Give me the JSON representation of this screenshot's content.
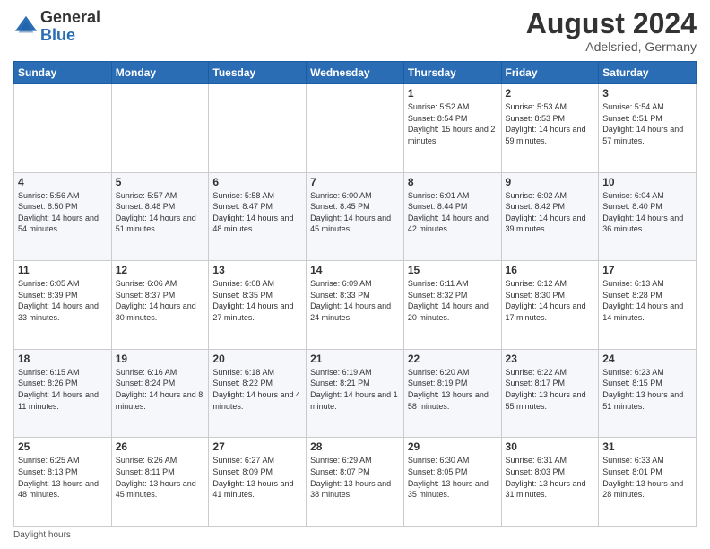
{
  "header": {
    "logo_general": "General",
    "logo_blue": "Blue",
    "month_year": "August 2024",
    "location": "Adelsried, Germany"
  },
  "days_of_week": [
    "Sunday",
    "Monday",
    "Tuesday",
    "Wednesday",
    "Thursday",
    "Friday",
    "Saturday"
  ],
  "weeks": [
    [
      {
        "day": "",
        "sunrise": "",
        "sunset": "",
        "daylight": ""
      },
      {
        "day": "",
        "sunrise": "",
        "sunset": "",
        "daylight": ""
      },
      {
        "day": "",
        "sunrise": "",
        "sunset": "",
        "daylight": ""
      },
      {
        "day": "",
        "sunrise": "",
        "sunset": "",
        "daylight": ""
      },
      {
        "day": "1",
        "sunrise": "Sunrise: 5:52 AM",
        "sunset": "Sunset: 8:54 PM",
        "daylight": "Daylight: 15 hours and 2 minutes."
      },
      {
        "day": "2",
        "sunrise": "Sunrise: 5:53 AM",
        "sunset": "Sunset: 8:53 PM",
        "daylight": "Daylight: 14 hours and 59 minutes."
      },
      {
        "day": "3",
        "sunrise": "Sunrise: 5:54 AM",
        "sunset": "Sunset: 8:51 PM",
        "daylight": "Daylight: 14 hours and 57 minutes."
      }
    ],
    [
      {
        "day": "4",
        "sunrise": "Sunrise: 5:56 AM",
        "sunset": "Sunset: 8:50 PM",
        "daylight": "Daylight: 14 hours and 54 minutes."
      },
      {
        "day": "5",
        "sunrise": "Sunrise: 5:57 AM",
        "sunset": "Sunset: 8:48 PM",
        "daylight": "Daylight: 14 hours and 51 minutes."
      },
      {
        "day": "6",
        "sunrise": "Sunrise: 5:58 AM",
        "sunset": "Sunset: 8:47 PM",
        "daylight": "Daylight: 14 hours and 48 minutes."
      },
      {
        "day": "7",
        "sunrise": "Sunrise: 6:00 AM",
        "sunset": "Sunset: 8:45 PM",
        "daylight": "Daylight: 14 hours and 45 minutes."
      },
      {
        "day": "8",
        "sunrise": "Sunrise: 6:01 AM",
        "sunset": "Sunset: 8:44 PM",
        "daylight": "Daylight: 14 hours and 42 minutes."
      },
      {
        "day": "9",
        "sunrise": "Sunrise: 6:02 AM",
        "sunset": "Sunset: 8:42 PM",
        "daylight": "Daylight: 14 hours and 39 minutes."
      },
      {
        "day": "10",
        "sunrise": "Sunrise: 6:04 AM",
        "sunset": "Sunset: 8:40 PM",
        "daylight": "Daylight: 14 hours and 36 minutes."
      }
    ],
    [
      {
        "day": "11",
        "sunrise": "Sunrise: 6:05 AM",
        "sunset": "Sunset: 8:39 PM",
        "daylight": "Daylight: 14 hours and 33 minutes."
      },
      {
        "day": "12",
        "sunrise": "Sunrise: 6:06 AM",
        "sunset": "Sunset: 8:37 PM",
        "daylight": "Daylight: 14 hours and 30 minutes."
      },
      {
        "day": "13",
        "sunrise": "Sunrise: 6:08 AM",
        "sunset": "Sunset: 8:35 PM",
        "daylight": "Daylight: 14 hours and 27 minutes."
      },
      {
        "day": "14",
        "sunrise": "Sunrise: 6:09 AM",
        "sunset": "Sunset: 8:33 PM",
        "daylight": "Daylight: 14 hours and 24 minutes."
      },
      {
        "day": "15",
        "sunrise": "Sunrise: 6:11 AM",
        "sunset": "Sunset: 8:32 PM",
        "daylight": "Daylight: 14 hours and 20 minutes."
      },
      {
        "day": "16",
        "sunrise": "Sunrise: 6:12 AM",
        "sunset": "Sunset: 8:30 PM",
        "daylight": "Daylight: 14 hours and 17 minutes."
      },
      {
        "day": "17",
        "sunrise": "Sunrise: 6:13 AM",
        "sunset": "Sunset: 8:28 PM",
        "daylight": "Daylight: 14 hours and 14 minutes."
      }
    ],
    [
      {
        "day": "18",
        "sunrise": "Sunrise: 6:15 AM",
        "sunset": "Sunset: 8:26 PM",
        "daylight": "Daylight: 14 hours and 11 minutes."
      },
      {
        "day": "19",
        "sunrise": "Sunrise: 6:16 AM",
        "sunset": "Sunset: 8:24 PM",
        "daylight": "Daylight: 14 hours and 8 minutes."
      },
      {
        "day": "20",
        "sunrise": "Sunrise: 6:18 AM",
        "sunset": "Sunset: 8:22 PM",
        "daylight": "Daylight: 14 hours and 4 minutes."
      },
      {
        "day": "21",
        "sunrise": "Sunrise: 6:19 AM",
        "sunset": "Sunset: 8:21 PM",
        "daylight": "Daylight: 14 hours and 1 minute."
      },
      {
        "day": "22",
        "sunrise": "Sunrise: 6:20 AM",
        "sunset": "Sunset: 8:19 PM",
        "daylight": "Daylight: 13 hours and 58 minutes."
      },
      {
        "day": "23",
        "sunrise": "Sunrise: 6:22 AM",
        "sunset": "Sunset: 8:17 PM",
        "daylight": "Daylight: 13 hours and 55 minutes."
      },
      {
        "day": "24",
        "sunrise": "Sunrise: 6:23 AM",
        "sunset": "Sunset: 8:15 PM",
        "daylight": "Daylight: 13 hours and 51 minutes."
      }
    ],
    [
      {
        "day": "25",
        "sunrise": "Sunrise: 6:25 AM",
        "sunset": "Sunset: 8:13 PM",
        "daylight": "Daylight: 13 hours and 48 minutes."
      },
      {
        "day": "26",
        "sunrise": "Sunrise: 6:26 AM",
        "sunset": "Sunset: 8:11 PM",
        "daylight": "Daylight: 13 hours and 45 minutes."
      },
      {
        "day": "27",
        "sunrise": "Sunrise: 6:27 AM",
        "sunset": "Sunset: 8:09 PM",
        "daylight": "Daylight: 13 hours and 41 minutes."
      },
      {
        "day": "28",
        "sunrise": "Sunrise: 6:29 AM",
        "sunset": "Sunset: 8:07 PM",
        "daylight": "Daylight: 13 hours and 38 minutes."
      },
      {
        "day": "29",
        "sunrise": "Sunrise: 6:30 AM",
        "sunset": "Sunset: 8:05 PM",
        "daylight": "Daylight: 13 hours and 35 minutes."
      },
      {
        "day": "30",
        "sunrise": "Sunrise: 6:31 AM",
        "sunset": "Sunset: 8:03 PM",
        "daylight": "Daylight: 13 hours and 31 minutes."
      },
      {
        "day": "31",
        "sunrise": "Sunrise: 6:33 AM",
        "sunset": "Sunset: 8:01 PM",
        "daylight": "Daylight: 13 hours and 28 minutes."
      }
    ]
  ],
  "footer": {
    "note": "Daylight hours"
  }
}
